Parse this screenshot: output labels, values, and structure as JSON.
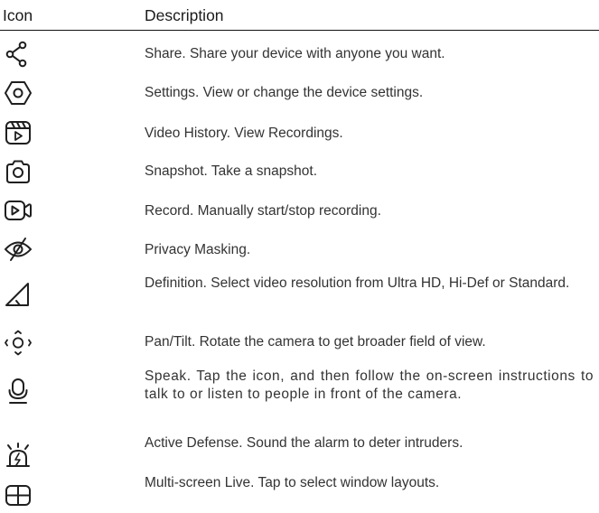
{
  "header": {
    "icon_col": "Icon",
    "desc_col": "Description"
  },
  "rows": [
    {
      "icon": "share-icon",
      "text": "Share. Share your device with anyone you want."
    },
    {
      "icon": "settings-icon",
      "text": "Settings. View or change the device settings."
    },
    {
      "icon": "video-history-icon",
      "text": "Video History. View Recordings."
    },
    {
      "icon": "camera-icon",
      "text": "Snapshot. Take a snapshot."
    },
    {
      "icon": "record-icon",
      "text": "Record. Manually start/stop recording."
    },
    {
      "icon": "eye-off-icon",
      "text": "Privacy Masking."
    },
    {
      "icon": "signal-triangle-icon",
      "text": "Definition. Select video resolution from Ultra HD, Hi-Def or Standard."
    },
    {
      "icon": "pan-tilt-icon",
      "text": "Pan/Tilt. Rotate the camera to get broader field of view."
    },
    {
      "icon": "microphone-icon",
      "text": "Speak. Tap the icon, and then follow the on-screen instructions to talk to or listen to people in front of the camera."
    },
    {
      "icon": "alarm-icon",
      "text": "Active Defense. Sound the alarm to deter intruders."
    },
    {
      "icon": "grid-icon",
      "text": "Multi-screen Live. Tap to select window layouts."
    }
  ]
}
